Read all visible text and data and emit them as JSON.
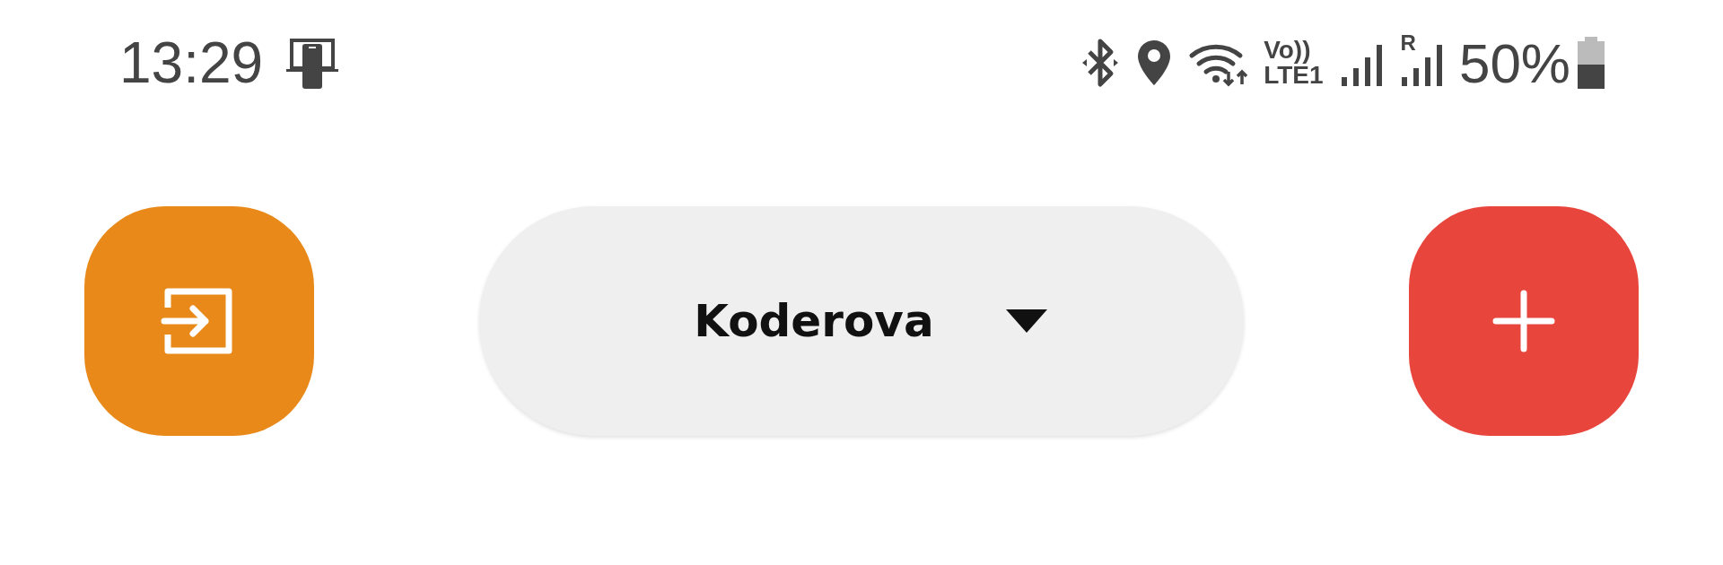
{
  "status_bar": {
    "time": "13:29",
    "volte": "Vo))",
    "network": "LTE1",
    "roaming": "R",
    "battery": "50%"
  },
  "toolbar": {
    "location": "Koderova"
  }
}
